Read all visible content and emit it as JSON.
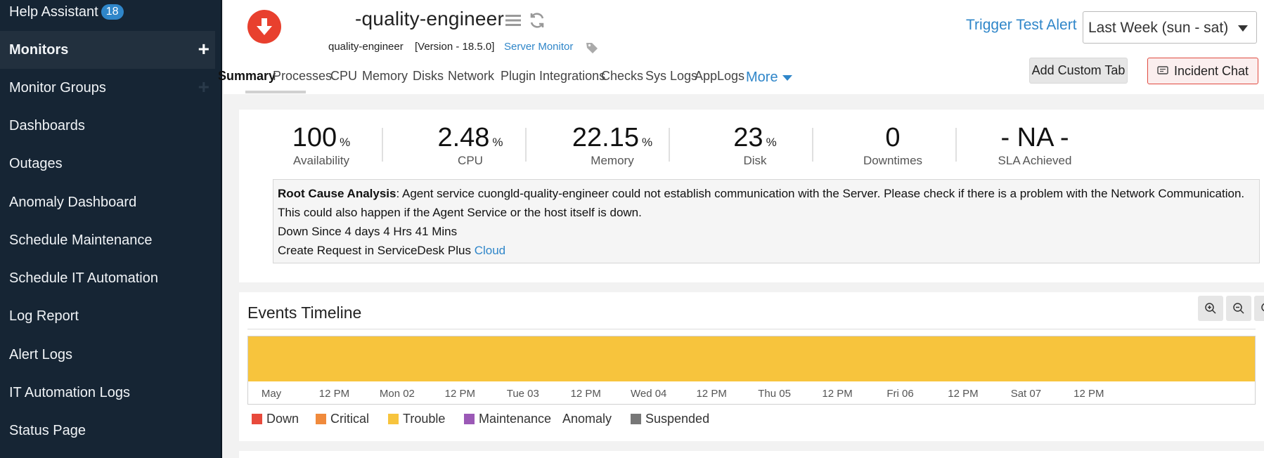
{
  "sidebar": {
    "help_label": "Help Assistant",
    "help_badge": "18",
    "items": [
      {
        "label": "Monitors"
      },
      {
        "label": "Monitor Groups"
      },
      {
        "label": "Dashboards"
      },
      {
        "label": "Outages"
      },
      {
        "label": "Anomaly Dashboard"
      },
      {
        "label": "Schedule Maintenance"
      },
      {
        "label": "Schedule IT Automation"
      },
      {
        "label": "Log Report"
      },
      {
        "label": "Alert Logs"
      },
      {
        "label": "IT Automation Logs"
      },
      {
        "label": "Status Page"
      }
    ],
    "plus": "+"
  },
  "header": {
    "status_icon": "down-arrow-icon",
    "status_color": "#e8402e",
    "title": "-quality-engineer",
    "monitor_name": "quality-engineer",
    "version": "[Version - 18.5.0]",
    "monitor_type": "Server Monitor",
    "trigger_test_alert": "Trigger Test Alert",
    "period_select": "Last Week (sun - sat)",
    "add_custom_tab": "Add Custom Tab",
    "incident_chat": "Incident Chat"
  },
  "tabs": [
    "Summary",
    "Processes",
    "CPU",
    "Memory",
    "Disks",
    "Network",
    "Plugin Integrations",
    "Checks",
    "Sys Logs",
    "AppLogs"
  ],
  "more_label": "More",
  "stats": [
    {
      "value": "100",
      "unit": "%",
      "label": "Availability"
    },
    {
      "value": "2.48",
      "unit": "%",
      "label": "CPU"
    },
    {
      "value": "22.15",
      "unit": "%",
      "label": "Memory"
    },
    {
      "value": "23",
      "unit": "%",
      "label": "Disk"
    },
    {
      "value": "0",
      "unit": "",
      "label": "Downtimes"
    },
    {
      "value": "- NA -",
      "unit": "",
      "label": "SLA Achieved"
    }
  ],
  "rca": {
    "heading": "Root Cause Analysis",
    "text": ": Agent service cuongld-quality-engineer could not establish communication with the Server. Please check if there is a problem with the Network Communication. This could also happen if the Agent Service or the host itself is down.",
    "down_since": "Down Since 4 days 4 Hrs 41 Mins",
    "create_request": "Create Request in ServiceDesk Plus ",
    "cloud_link": "Cloud"
  },
  "timeline": {
    "title": "Events Timeline",
    "bar_status": "Trouble",
    "bar_color": "#f7c43d",
    "ticks": [
      "May",
      "12 PM",
      "Mon 02",
      "12 PM",
      "Tue 03",
      "12 PM",
      "Wed 04",
      "12 PM",
      "Thu 05",
      "12 PM",
      "Fri 06",
      "12 PM",
      "Sat 07",
      "12 PM"
    ],
    "legend": [
      {
        "label": "Down",
        "color": "#e84a3c"
      },
      {
        "label": "Critical",
        "color": "#f08a3c"
      },
      {
        "label": "Trouble",
        "color": "#f7c43d"
      },
      {
        "label": "Maintenance",
        "color": "#9b59b6"
      },
      {
        "label": "Anomaly",
        "color": ""
      },
      {
        "label": "Suspended",
        "color": "#777777"
      }
    ]
  }
}
